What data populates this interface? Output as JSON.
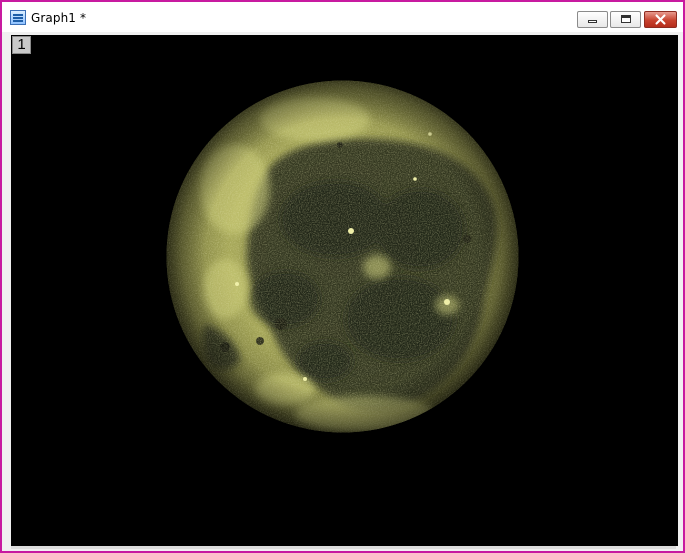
{
  "window": {
    "title": "Graph1 *",
    "border_color": "#c81aa0"
  },
  "titlebar": {
    "icon": "graph-window-icon",
    "buttons": [
      {
        "name": "minimize",
        "icon": "minimize-icon"
      },
      {
        "name": "maximize",
        "icon": "maximize-icon"
      },
      {
        "name": "close",
        "icon": "close-icon"
      }
    ]
  },
  "graph": {
    "layer_label": "1",
    "background_color": "#000000",
    "image": {
      "subject": "moon",
      "tint_color": "#c7c86a"
    }
  }
}
